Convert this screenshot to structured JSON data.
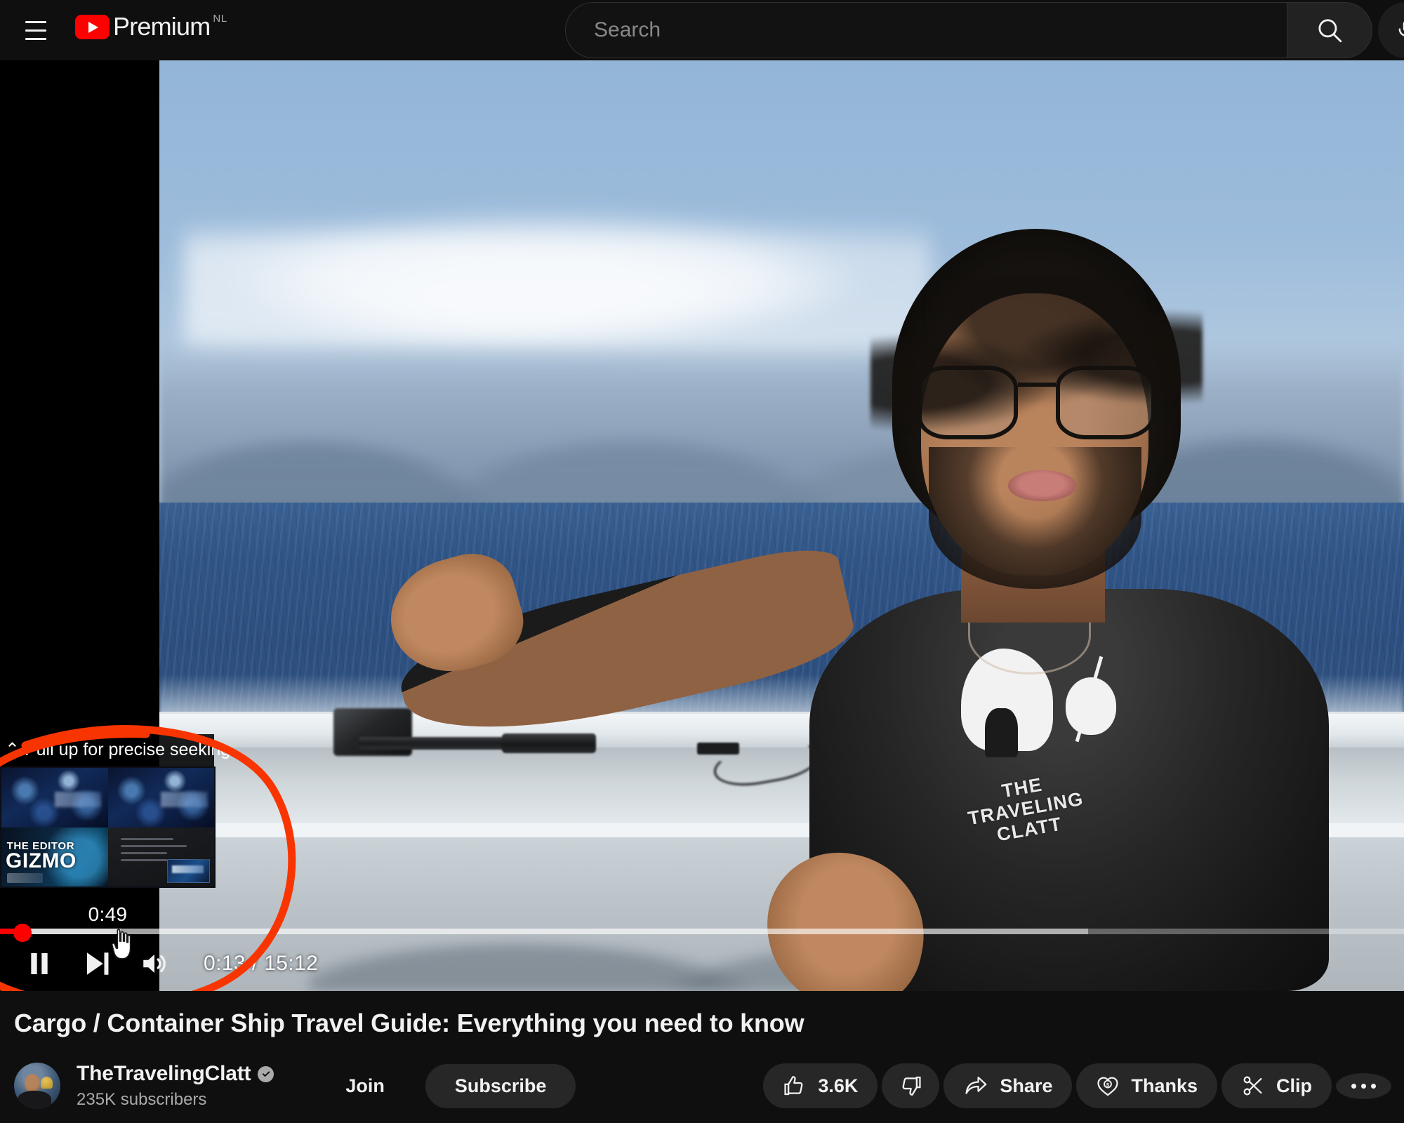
{
  "header": {
    "menu_icon": "hamburger-menu-icon",
    "logo_icon": "youtube-play-logo-icon",
    "brand_text": "Premium",
    "brand_locale": "NL",
    "search": {
      "placeholder": "Search",
      "value": "",
      "button_icon": "search-icon"
    },
    "voice_icon": "microphone-icon"
  },
  "player": {
    "seek_preview": {
      "hint_text": "Pull up for precise seeking",
      "hint_icon": "chevron-up-icon",
      "timestamp": "0:49",
      "thumbnail_texts": {
        "line1": "THE EDITOR",
        "line2": "GIZMO"
      }
    },
    "controls": {
      "pause_icon": "pause-icon",
      "next_icon": "next-video-icon",
      "volume_icon": "volume-on-icon",
      "time_current": "0:13",
      "time_separator": " / ",
      "time_total": "15:12",
      "time_display": "0:13 / 15:12"
    },
    "progress": {
      "played_percent": 1.6,
      "hover_percent": 8.6,
      "loaded_percent": 77.5,
      "accent_color": "#ff0000"
    },
    "annotation": {
      "shape": "hand-drawn-ellipse",
      "color": "#f83500"
    },
    "scene": {
      "shirt_text_line1": "THE",
      "shirt_text_line2": "TRAVELING",
      "shirt_text_line3": "CLATT"
    }
  },
  "video_info": {
    "title": "Cargo / Container Ship Travel Guide: Everything you need to know",
    "channel": {
      "name": "TheTravelingClatt",
      "verified_icon": "verified-badge-icon",
      "subscribers": "235K subscribers",
      "avatar_icon": "channel-avatar"
    },
    "join_label": "Join",
    "subscribe_label": "Subscribe",
    "actions": [
      {
        "name": "like",
        "icon": "thumbs-up-icon",
        "label": "3.6K"
      },
      {
        "name": "dislike",
        "icon": "thumbs-down-icon",
        "label": ""
      },
      {
        "name": "share",
        "icon": "share-arrow-icon",
        "label": "Share"
      },
      {
        "name": "thanks",
        "icon": "heart-dollar-icon",
        "label": "Thanks"
      },
      {
        "name": "clip",
        "icon": "scissors-icon",
        "label": "Clip"
      },
      {
        "name": "more",
        "icon": "more-horizontal-icon",
        "label": ""
      }
    ]
  },
  "colors": {
    "background": "#0f0f0f",
    "chip": "#272727",
    "text_primary": "#f1f1f1",
    "text_secondary": "#aaaaaa",
    "brand_red": "#ff0000"
  }
}
